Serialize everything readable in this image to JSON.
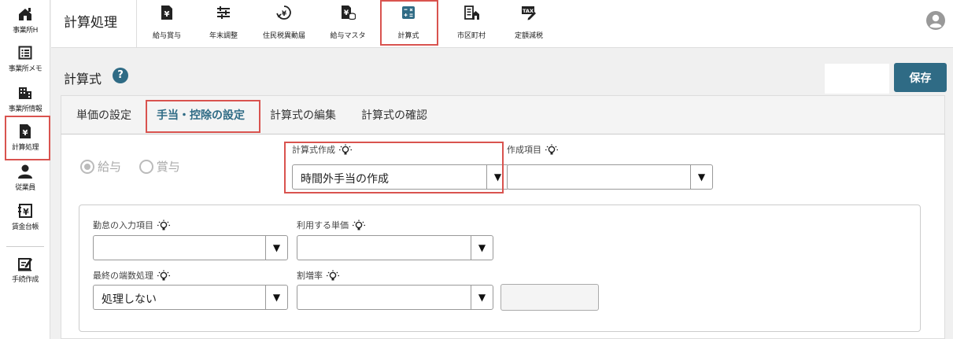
{
  "sidebar": {
    "items": [
      {
        "label": "事業所H",
        "icon": "building-home-icon"
      },
      {
        "label": "事業所メモ",
        "icon": "memo-list-icon"
      },
      {
        "label": "事業所情報",
        "icon": "office-building-icon"
      },
      {
        "label": "計算処理",
        "icon": "yen-document-icon"
      },
      {
        "label": "従業員",
        "icon": "person-icon"
      },
      {
        "label": "賃金台帳",
        "icon": "yen-ledger-icon"
      },
      {
        "label": "手続作成",
        "icon": "edit-form-icon"
      }
    ]
  },
  "header": {
    "title": "計算処理",
    "nav": [
      {
        "label": "給与賞与",
        "icon": "yen-document-icon"
      },
      {
        "label": "年末調整",
        "icon": "sliders-icon"
      },
      {
        "label": "住民税異動届",
        "icon": "yen-rotate-icon"
      },
      {
        "label": "給与マスタ",
        "icon": "yen-database-icon"
      },
      {
        "label": "計算式",
        "icon": "calculator-icon"
      },
      {
        "label": "市区町村",
        "icon": "city-office-icon"
      },
      {
        "label": "定額減税",
        "icon": "tax-tag-icon"
      }
    ]
  },
  "main": {
    "title": "計算式",
    "help": "?",
    "save_label": "保存",
    "tabs": [
      {
        "label": "単価の設定"
      },
      {
        "label": "手当・控除の設定"
      },
      {
        "label": "計算式の編集"
      },
      {
        "label": "計算式の確認"
      }
    ],
    "radios": [
      {
        "label": "給与",
        "checked": true
      },
      {
        "label": "賞与",
        "checked": false
      }
    ],
    "formula": {
      "label": "計算式作成",
      "value": "時間外手当の作成"
    },
    "item": {
      "label": "作成項目",
      "value": ""
    },
    "attendance": {
      "label": "勤怠の入力項目",
      "value": ""
    },
    "unit_price": {
      "label": "利用する単価",
      "value": ""
    },
    "rounding": {
      "label": "最終の端数処理",
      "value": "処理しない"
    },
    "premium_rate": {
      "label": "割増率",
      "value": ""
    },
    "dropdown_arrow": "▼"
  },
  "colors": {
    "accent": "#2f6b85",
    "highlight": "#d9534f"
  }
}
